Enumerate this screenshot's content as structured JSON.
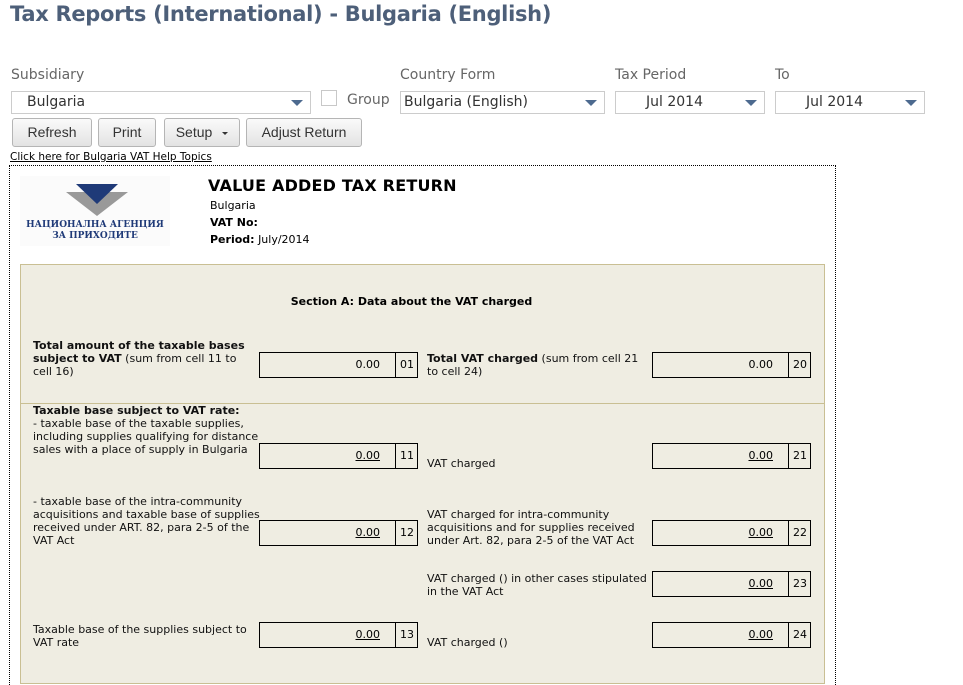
{
  "page": {
    "title": "Tax Reports (International) - Bulgaria (English)"
  },
  "filters": {
    "subsidiary": {
      "label": "Subsidiary",
      "value": "Bulgaria"
    },
    "group": {
      "label": "Group",
      "checked": false
    },
    "country_form": {
      "label": "Country Form",
      "value": "Bulgaria (English)"
    },
    "tax_period": {
      "label": "Tax Period",
      "value": "Jul 2014"
    },
    "to": {
      "label": "To",
      "value": "Jul 2014"
    }
  },
  "toolbar": {
    "refresh_label": "Refresh",
    "print_label": "Print",
    "setup_label": "Setup",
    "adjust_return_label": "Adjust Return"
  },
  "help_link": "Click here for Bulgaria VAT Help Topics",
  "report": {
    "logo": {
      "icon": "nra-logo-triangle",
      "line1": "НАЦИОНАЛНА АГЕНЦИЯ",
      "line2": "ЗА ПРИХОДИТЕ",
      "colors": {
        "blue": "#1f3a78",
        "gray": "#999999"
      }
    },
    "title": "VALUE ADDED TAX RETURN",
    "country": "Bulgaria",
    "vat_no_label": "VAT No:",
    "vat_no_value": "",
    "period_label": "Period:",
    "period_value": "July/2014",
    "section_a": {
      "title": "Section A: Data about the VAT charged",
      "background": "#efede2",
      "border": "#c9bf93",
      "totals": {
        "left": {
          "label_bold": "Total amount of the taxable bases subject to VAT",
          "label_rest": " (sum from cell 11 to cell 16)",
          "amount": "0.00",
          "cell": "01"
        },
        "right": {
          "label_bold": "Total VAT charged",
          "label_rest": " (sum from cell 21 to cell 24)",
          "amount": "0.00",
          "cell": "20"
        }
      },
      "subheading": "Taxable base subject to VAT rate:",
      "rows": [
        {
          "left_label": "- taxable base of the taxable supplies, including supplies qualifying for distance sales with a place of supply in Bulgaria",
          "left_amount": "0.00",
          "left_cell": "11",
          "right_label": "VAT charged",
          "right_amount": "0.00",
          "right_cell": "21"
        },
        {
          "left_label": "- taxable base of the intra-community acquisitions and taxable base of supplies received under ART. 82, para 2-5 of the VAT Act",
          "left_amount": "0.00",
          "left_cell": "12",
          "right_label": "VAT charged for intra-community acquisitions and for supplies received under Art. 82, para 2-5 of the VAT Act",
          "right_amount": "0.00",
          "right_cell": "22"
        },
        {
          "left_label": "",
          "right_label": "VAT charged () in other cases stipulated in the VAT Act",
          "right_amount": "0.00",
          "right_cell": "23"
        },
        {
          "left_label": "Taxable base of the supplies subject to VAT rate",
          "left_amount": "0.00",
          "left_cell": "13",
          "right_label": "VAT charged ()",
          "right_amount": "0.00",
          "right_cell": "24"
        }
      ]
    }
  }
}
